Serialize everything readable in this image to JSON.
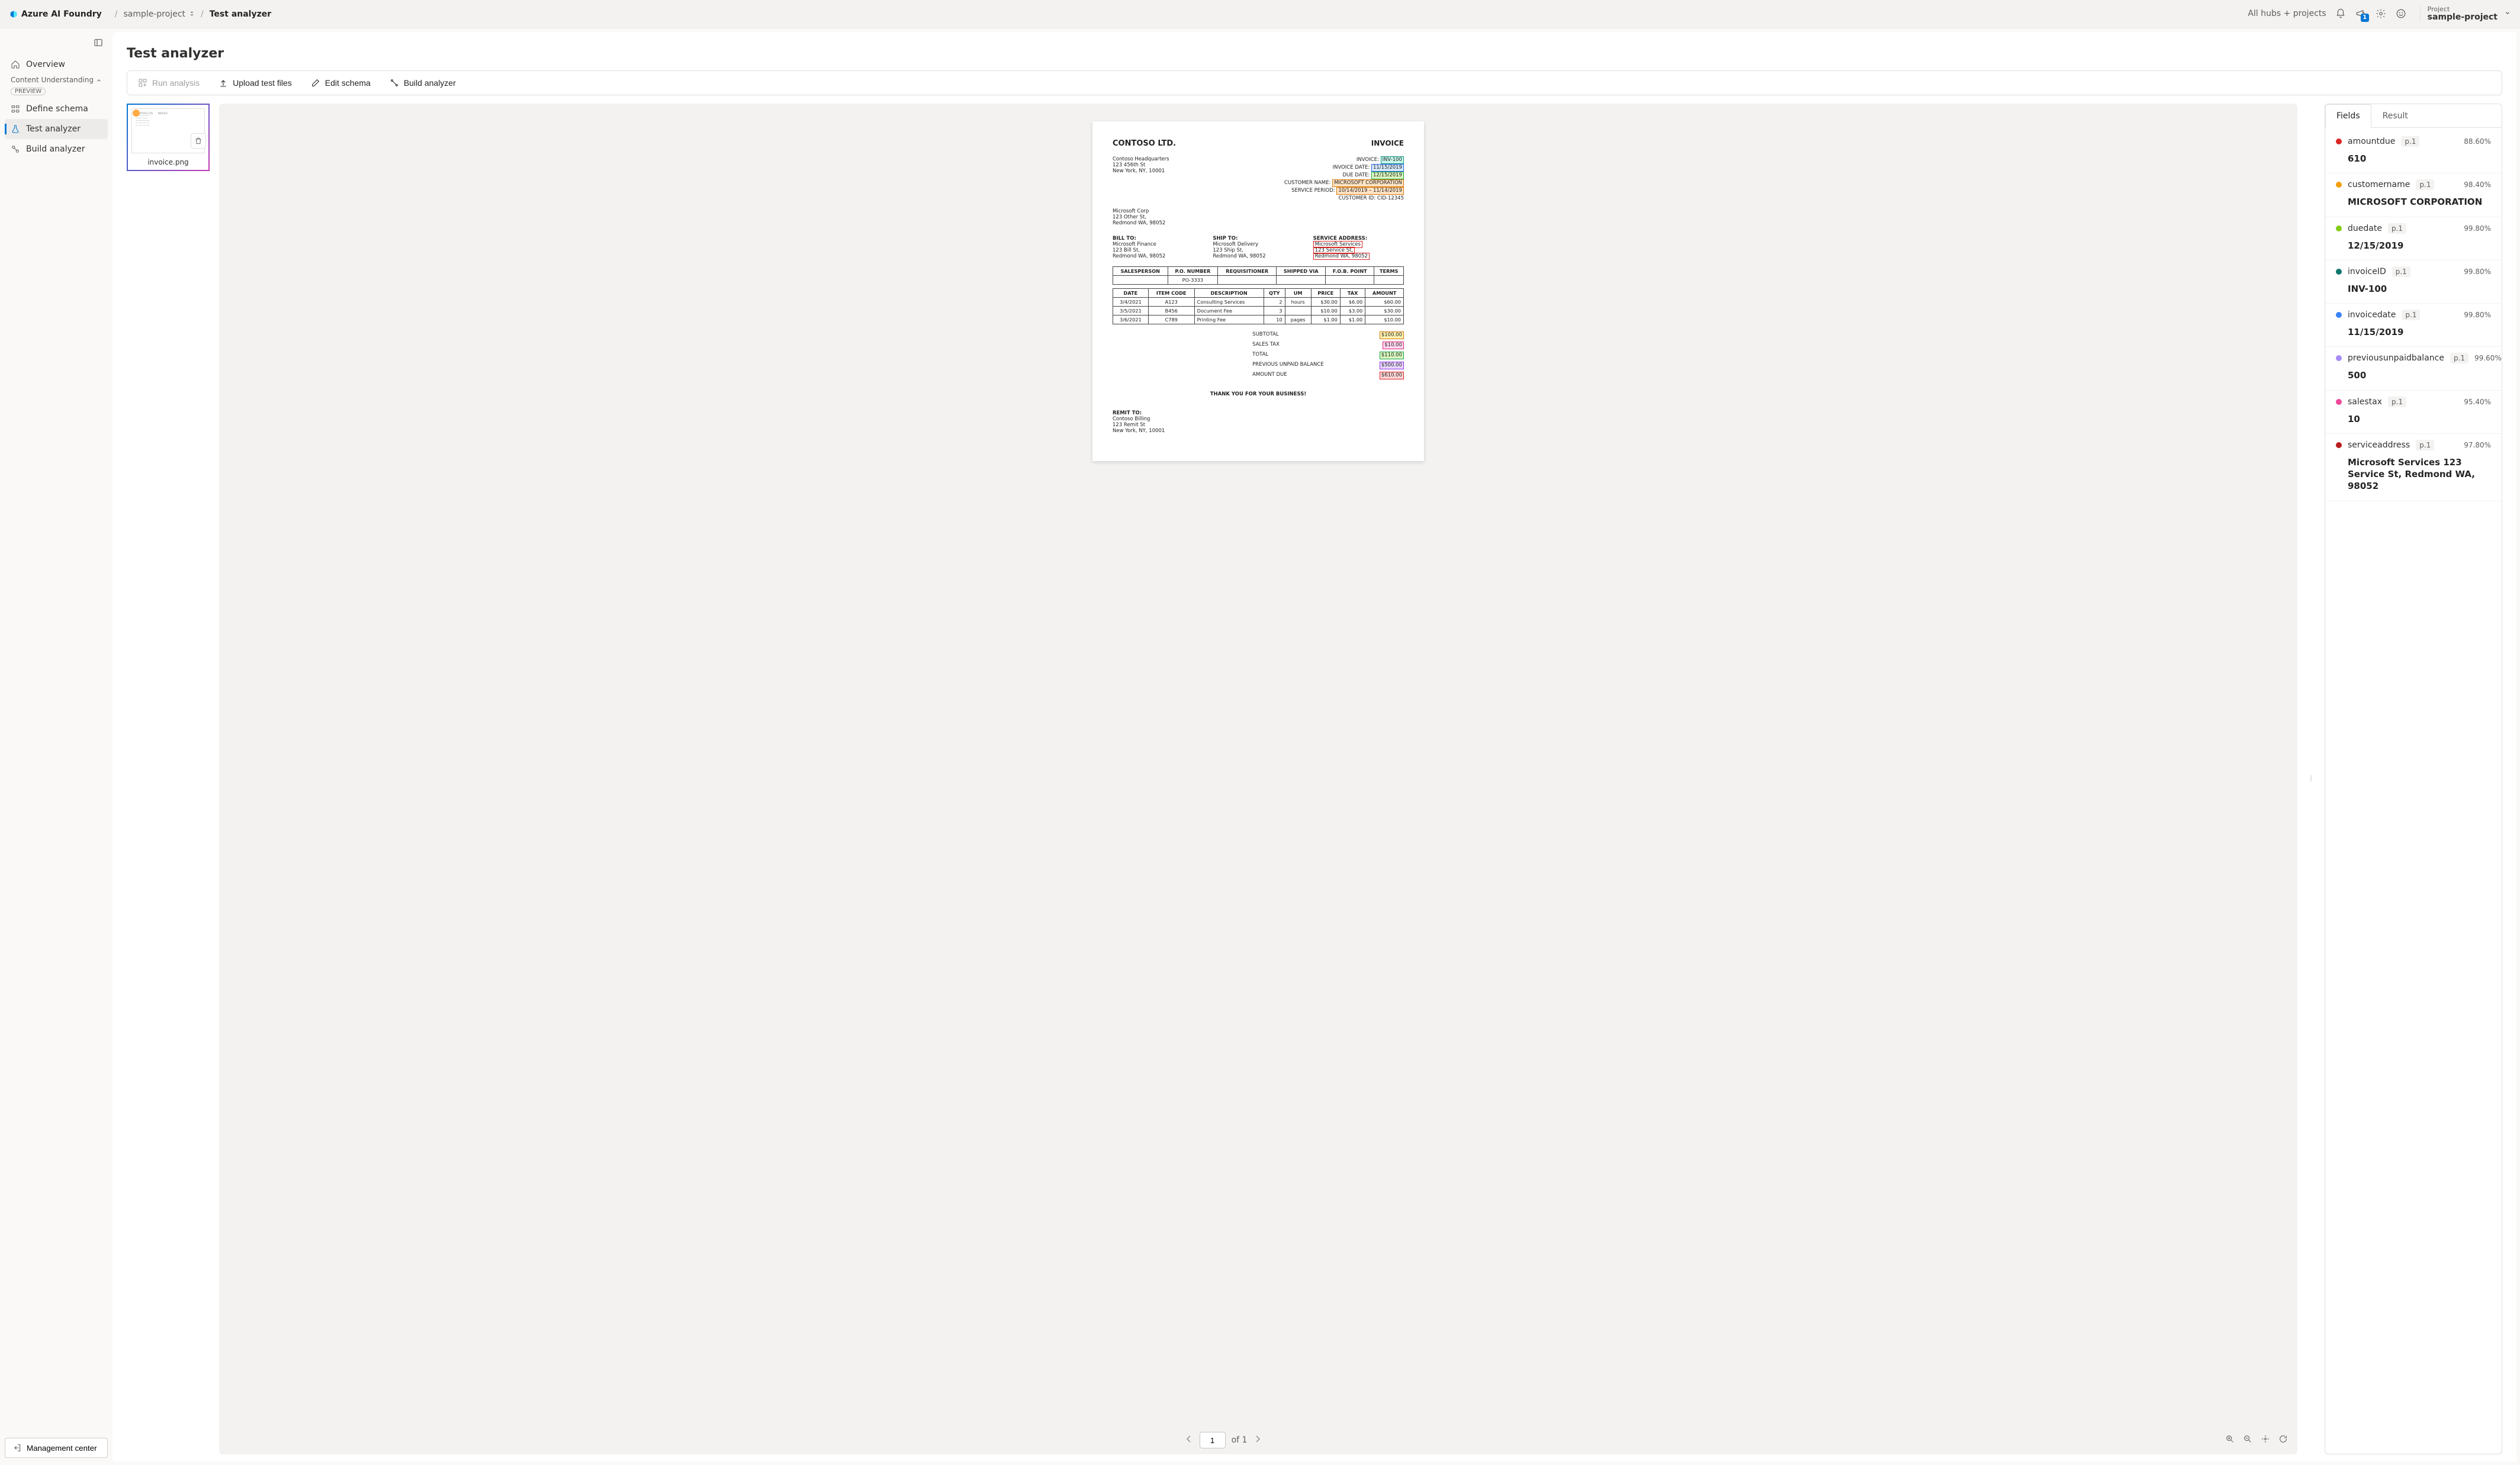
{
  "header": {
    "brand": "Azure AI Foundry",
    "breadcrumb_project": "sample-project",
    "breadcrumb_current": "Test analyzer",
    "hubs_link": "All hubs + projects",
    "announcement_badge": "1",
    "project_label": "Project",
    "project_value": "sample-project"
  },
  "sidebar": {
    "overview": "Overview",
    "section_title": "Content Understanding",
    "preview_pill": "PREVIEW",
    "define_schema": "Define schema",
    "test_analyzer": "Test analyzer",
    "build_analyzer": "Build analyzer",
    "management_center": "Management center"
  },
  "page": {
    "title": "Test analyzer",
    "toolbar": {
      "run_analysis": "Run analysis",
      "upload": "Upload test files",
      "edit_schema": "Edit schema",
      "build_analyzer": "Build analyzer"
    },
    "thumb_name": "invoice.png",
    "viewer_footer": {
      "page_value": "1",
      "page_total": "of 1"
    },
    "tabs": {
      "fields": "Fields",
      "result": "Result"
    }
  },
  "invoice": {
    "company": "CONTOSO LTD.",
    "doc_label": "INVOICE",
    "hq_name": "Contoso Headquarters",
    "hq_street": "123 456th St",
    "hq_city": "New York, NY, 10001",
    "inv_no_label": "INVOICE:",
    "inv_no": "INV-100",
    "inv_date_label": "INVOICE DATE:",
    "inv_date": "11/15/2019",
    "due_date_label": "DUE DATE:",
    "due_date": "12/15/2019",
    "cust_name_label": "CUSTOMER NAME:",
    "cust_name": "MICROSOFT CORPORATION",
    "svc_period_label": "SERVICE PERIOD:",
    "svc_period": "10/14/2019 – 11/14/2019",
    "cust_id_label": "CUSTOMER ID:",
    "cust_id": "CID-12345",
    "cust_co": "Microsoft Corp",
    "cust_street": "123 Other St,",
    "cust_city": "Redmond WA, 98052",
    "bill_to_label": "BILL TO:",
    "bill_to_name": "Microsoft Finance",
    "bill_to_street": "123 Bill St,",
    "bill_to_city": "Redmond WA, 98052",
    "ship_to_label": "SHIP TO:",
    "ship_to_name": "Microsoft Delivery",
    "ship_to_street": "123 Ship St,",
    "ship_to_city": "Redmond WA, 98052",
    "svc_addr_label": "SERVICE ADDRESS:",
    "svc_addr_name": "Microsoft Services",
    "svc_addr_street": "123 Service St,",
    "svc_addr_city": "Redmond WA, 98052",
    "th": {
      "sales": "SALESPERSON",
      "po": "P.O. NUMBER",
      "req": "REQUISITIONER",
      "ship": "SHIPPED VIA",
      "fob": "F.O.B. POINT",
      "terms": "TERMS"
    },
    "po_value": "PO-3333",
    "th2": {
      "date": "DATE",
      "item": "ITEM CODE",
      "desc": "DESCRIPTION",
      "qty": "QTY",
      "um": "UM",
      "price": "PRICE",
      "tax": "TAX",
      "amount": "AMOUNT"
    },
    "rows": [
      {
        "date": "3/4/2021",
        "item": "A123",
        "desc": "Consulting Services",
        "qty": "2",
        "um": "hours",
        "price": "$30.00",
        "tax": "$6.00",
        "amount": "$60.00"
      },
      {
        "date": "3/5/2021",
        "item": "B456",
        "desc": "Document Fee",
        "qty": "3",
        "um": "",
        "price": "$10.00",
        "tax": "$3.00",
        "amount": "$30.00"
      },
      {
        "date": "3/6/2021",
        "item": "C789",
        "desc": "Printing Fee",
        "qty": "10",
        "um": "pages",
        "price": "$1.00",
        "tax": "$1.00",
        "amount": "$10.00"
      }
    ],
    "subtotal_label": "SUBTOTAL",
    "subtotal": "$100.00",
    "salestax_label": "SALES TAX",
    "salestax": "$10.00",
    "total_label": "TOTAL",
    "total": "$110.00",
    "prevbal_label": "PREVIOUS UNPAID BALANCE",
    "prevbal": "$500.00",
    "amtdue_label": "AMOUNT DUE",
    "amtdue": "$610.00",
    "thanks": "THANK YOU FOR YOUR BUSINESS!",
    "remit_label": "REMIT TO:",
    "remit_name": "Contoso Billing",
    "remit_street": "123 Remit St",
    "remit_city": "New York, NY, 10001"
  },
  "fields": [
    {
      "color": "#dc2626",
      "name": "amountdue",
      "page": "p.1",
      "conf": "88.60%",
      "value": "610"
    },
    {
      "color": "#f59e0b",
      "name": "customername",
      "page": "p.1",
      "conf": "98.40%",
      "value": "MICROSOFT CORPORATION"
    },
    {
      "color": "#84cc16",
      "name": "duedate",
      "page": "p.1",
      "conf": "99.80%",
      "value": "12/15/2019"
    },
    {
      "color": "#0f766e",
      "name": "invoiceID",
      "page": "p.1",
      "conf": "99.80%",
      "value": "INV-100"
    },
    {
      "color": "#3b82f6",
      "name": "invoicedate",
      "page": "p.1",
      "conf": "99.80%",
      "value": "11/15/2019"
    },
    {
      "color": "#a78bfa",
      "name": "previousunpaidbalance",
      "page": "p.1",
      "conf": "99.60%",
      "value": "500"
    },
    {
      "color": "#ec4899",
      "name": "salestax",
      "page": "p.1",
      "conf": "95.40%",
      "value": "10"
    },
    {
      "color": "#b91c1c",
      "name": "serviceaddress",
      "page": "p.1",
      "conf": "97.80%",
      "value": "Microsoft Services 123 Service St, Redmond WA, 98052"
    }
  ]
}
